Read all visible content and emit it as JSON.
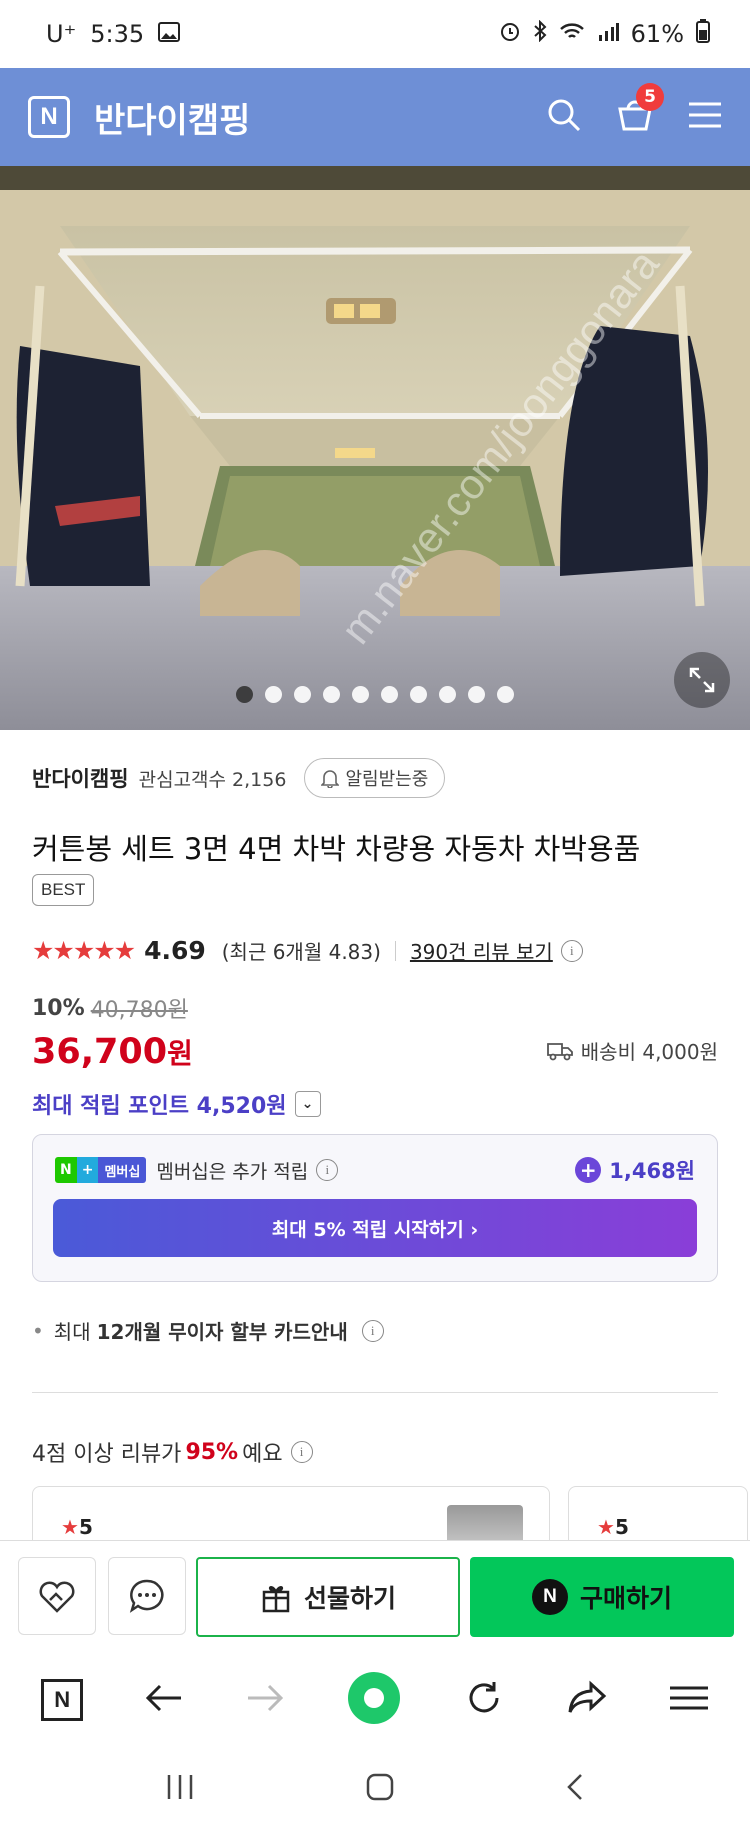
{
  "status_bar": {
    "carrier": "U⁺",
    "time": "5:35",
    "battery": "61%"
  },
  "app_bar": {
    "title": "반다이캠핑",
    "cart_count": "5"
  },
  "gallery": {
    "total_images": 10,
    "current_index": 1,
    "watermark": "m.naver.com/joonggonara"
  },
  "store": {
    "name": "반다이캠핑",
    "interest_label": "관심고객수 2,156",
    "alarm_label": "알림받는중"
  },
  "product": {
    "title": "커튼봉 세트 3면 4면 차박 차량용 자동차 차박용품",
    "tag": "BEST",
    "stars": "★★★★★",
    "rating": "4.69",
    "recent_rating": "(최근 6개월 4.83)",
    "review_link": "390건 리뷰 보기",
    "discount_pct": "10%",
    "original_price": "40,780원",
    "price": "36,700",
    "price_unit": "원",
    "shipping": "배송비 4,000원",
    "max_points": "최대 적립 포인트 4,520원"
  },
  "membership": {
    "badge_n": "N",
    "badge_plus": "+",
    "badge_label": "멤버십",
    "text": "멤버십은 추가 적립",
    "points": "1,468원",
    "button": "최대 5% 적립 시작하기 ›"
  },
  "card": {
    "prefix": "최대",
    "bold": "12개월 무이자 할부 카드안내"
  },
  "review_summary": {
    "prefix": "4점 이상 리뷰가",
    "pct": "95%",
    "suffix": "예요"
  },
  "review_cards": [
    {
      "stars": "5"
    },
    {
      "stars": "5"
    }
  ],
  "bottom_bar": {
    "gift": "선물하기",
    "buy": "구매하기",
    "buy_icon": "N"
  },
  "browser_nav": {
    "home_logo": "N"
  }
}
